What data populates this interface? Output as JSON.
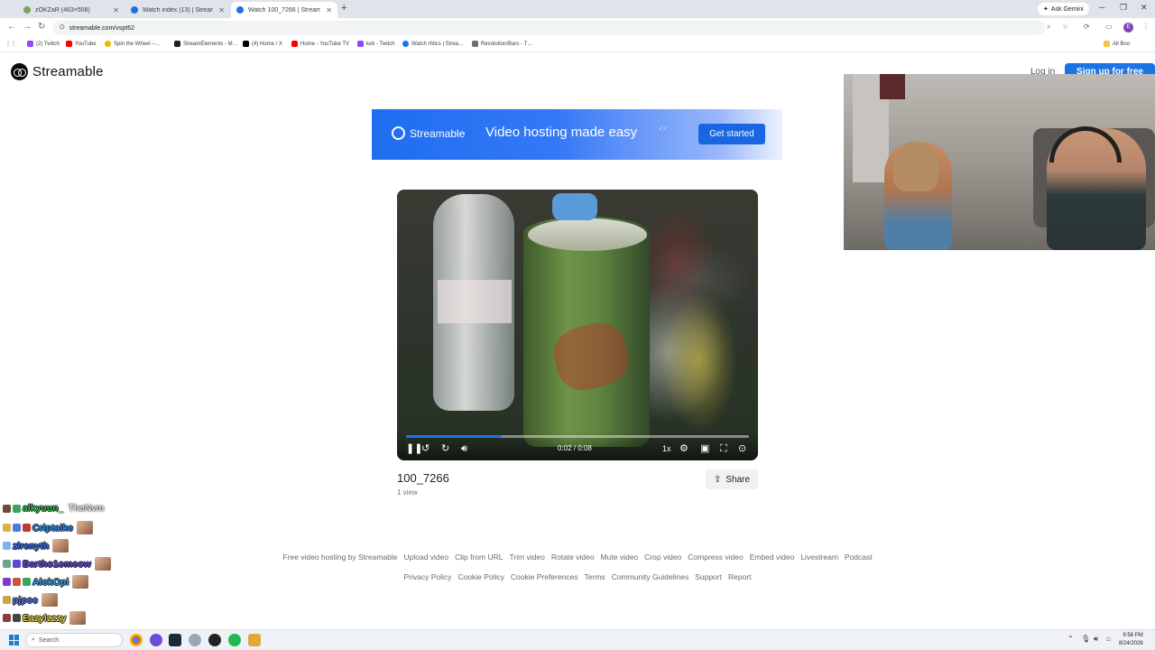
{
  "browser": {
    "tabs": [
      {
        "label": "zOKZaR (463×508)",
        "active": false
      },
      {
        "label": "Watch index (13) | Streamable",
        "active": false
      },
      {
        "label": "Watch 100_7266 | Streamable",
        "active": true
      }
    ],
    "new_tab_label": "+",
    "ask_gemini": "Ask Gemini",
    "url": "streamable.com/vspt62",
    "profile_initial": "E",
    "bookmarks": [
      "(2) Twitch",
      "YouTube",
      "Spin the Wheel –…",
      "StreamElements - M…",
      "(4) Home / X",
      "Home - YouTube TV",
      "kek - Twitch",
      "Watch rhtics | Strea…",
      "Revolution/Bars - T…",
      "All Boo"
    ]
  },
  "site": {
    "brand": "Streamable",
    "login": "Log in",
    "signup": "Sign up for free"
  },
  "banner": {
    "brand": "Streamable",
    "tagline": "Video hosting made easy",
    "cta": "Get started"
  },
  "player": {
    "time": "0:02 / 0:08",
    "speed": "1x",
    "progress_fraction": 0.28
  },
  "video_info": {
    "title": "100_7266",
    "views": "1 view",
    "share": "Share"
  },
  "footer": {
    "row1": [
      "Free video hosting by Streamable",
      "Upload video",
      "Clip from URL",
      "Trim video",
      "Rotate video",
      "Mute video",
      "Crop video",
      "Compress video",
      "Embed video",
      "Livestream",
      "Podcast"
    ],
    "row2": [
      "Privacy Policy",
      "Cookie Policy",
      "Cookie Preferences",
      "Terms",
      "Community Guidelines",
      "Support",
      "Report"
    ]
  },
  "chat": [
    {
      "user": "alkyuun_",
      "color": "#2fbf4f",
      "msg": "TheNvm"
    },
    {
      "user": "Criptaike",
      "color": "#2a8ff7",
      "msg": ""
    },
    {
      "user": "zlrenyth",
      "color": "#3a6df5",
      "msg": ""
    },
    {
      "user": "Bartho1omeow",
      "color": "#5b4de8",
      "msg": ""
    },
    {
      "user": "AlokOpi",
      "color": "#34a3f0",
      "msg": ""
    },
    {
      "user": "pjpoe",
      "color": "#4f7cf0",
      "msg": ""
    },
    {
      "user": "Eazylzzzy",
      "color": "#e8d23a",
      "msg": ""
    }
  ],
  "taskbar": {
    "search_placeholder": "Search",
    "time": "9:58 PM",
    "date": "8/24/2026"
  },
  "colors": {
    "accent": "#1b74e4",
    "banner_start": "#1d6ef0"
  }
}
